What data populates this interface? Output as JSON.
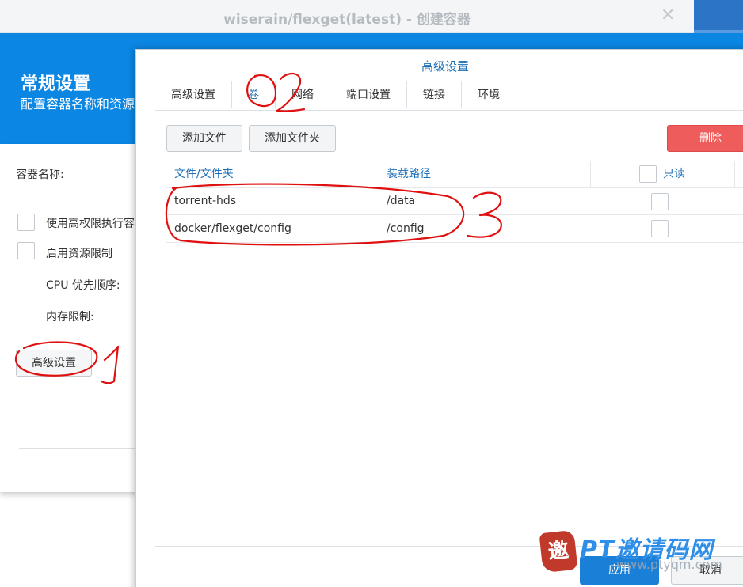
{
  "background_window": {
    "title": "wiserain/flexget(latest) - 创建容器",
    "header_title": "常规设置",
    "header_subtitle": "配置容器名称和资源",
    "container_name_label": "容器名称:",
    "privileged_label": "使用高权限执行容器",
    "resource_limit_label": "启用资源限制",
    "cpu_priority_label": "CPU 优先顺序:",
    "memory_limit_label": "内存限制:",
    "advanced_button": "高级设置"
  },
  "dialog": {
    "title": "高级设置",
    "tabs": [
      {
        "label": "高级设置",
        "active": false
      },
      {
        "label": "卷",
        "active": true
      },
      {
        "label": "网络",
        "active": false
      },
      {
        "label": "端口设置",
        "active": false
      },
      {
        "label": "链接",
        "active": false
      },
      {
        "label": "环境",
        "active": false
      }
    ],
    "toolbar": {
      "add_file": "添加文件",
      "add_folder": "添加文件夹",
      "delete": "删除"
    },
    "table": {
      "headers": {
        "file_folder": "文件/文件夹",
        "mount_path": "装载路径",
        "readonly": "只读"
      },
      "rows": [
        {
          "file_folder": "torrent-hds",
          "mount_path": "/data",
          "readonly": false
        },
        {
          "file_folder": "docker/flexget/config",
          "mount_path": "/config",
          "readonly": false
        }
      ]
    },
    "footer": {
      "apply": "应用",
      "cancel": "取消"
    }
  },
  "annotations": {
    "labels": [
      "1",
      "2",
      "3"
    ],
    "color": "#e01010"
  },
  "watermark": {
    "seal_char": "邀",
    "text": "PT邀请码网",
    "url": "www.ptyqm.com"
  },
  "colors": {
    "header_blue": "#0b86e3",
    "link_blue": "#1e6fb5",
    "delete_red": "#ee5c5c",
    "apply_blue": "#1a7fd6"
  }
}
